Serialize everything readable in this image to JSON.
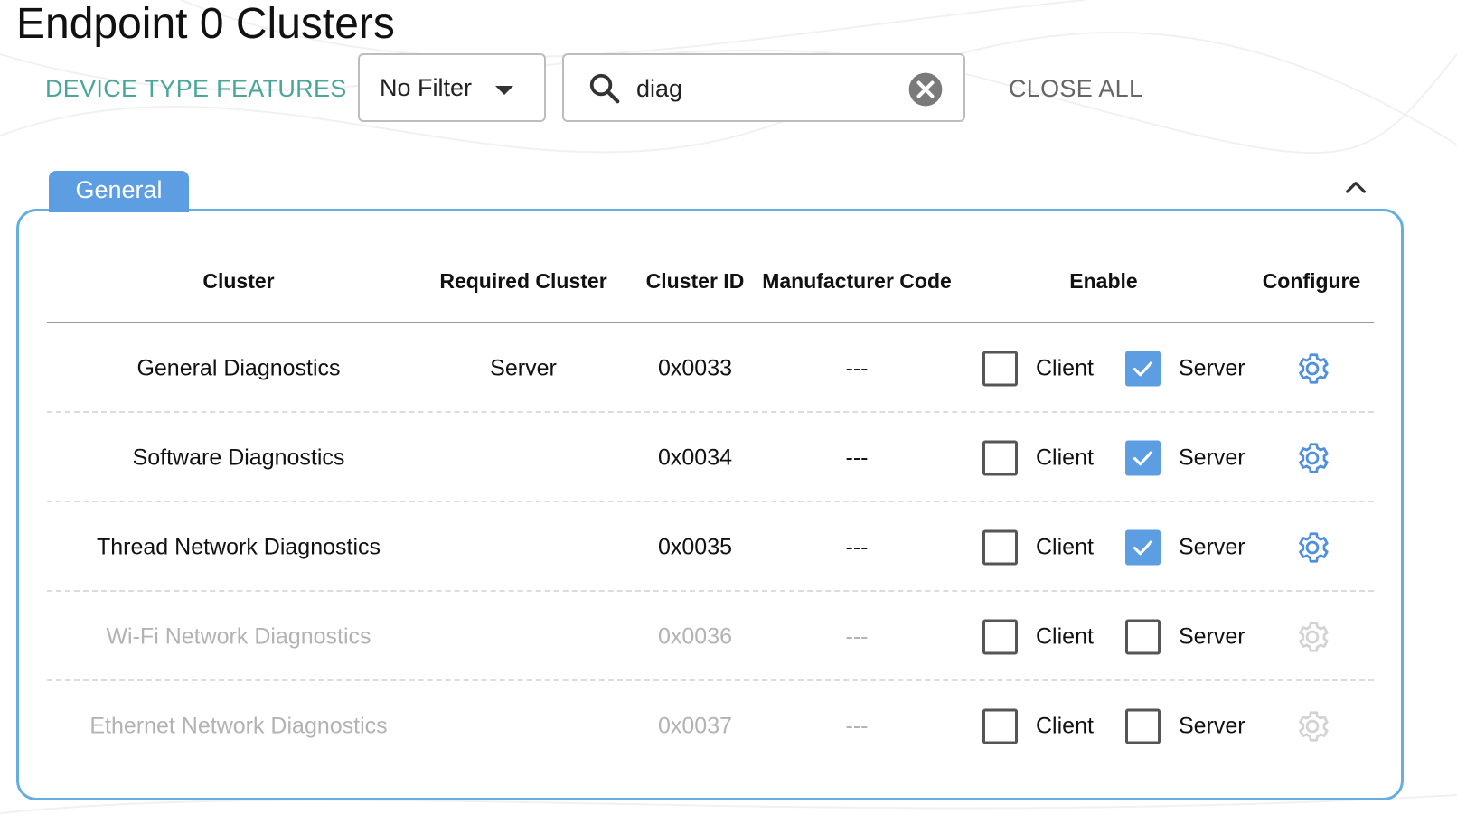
{
  "page_title": "Endpoint 0 Clusters",
  "toolbar": {
    "device_type_features": "DEVICE TYPE FEATURES",
    "filter_value": "No Filter",
    "search_value": "diag",
    "close_all": "CLOSE ALL"
  },
  "section": {
    "tab_label": "General"
  },
  "table": {
    "headers": {
      "cluster": "Cluster",
      "required": "Required Cluster",
      "cluster_id": "Cluster ID",
      "mfg_code": "Manufacturer Code",
      "enable": "Enable",
      "configure": "Configure"
    },
    "client_label": "Client",
    "server_label": "Server",
    "rows": [
      {
        "name": "General Diagnostics",
        "required": "Server",
        "id": "0x0033",
        "mfg": "---",
        "client": false,
        "server": true,
        "enabled": true
      },
      {
        "name": "Software Diagnostics",
        "required": "",
        "id": "0x0034",
        "mfg": "---",
        "client": false,
        "server": true,
        "enabled": true
      },
      {
        "name": "Thread Network Diagnostics",
        "required": "",
        "id": "0x0035",
        "mfg": "---",
        "client": false,
        "server": true,
        "enabled": true
      },
      {
        "name": "Wi-Fi Network Diagnostics",
        "required": "",
        "id": "0x0036",
        "mfg": "---",
        "client": false,
        "server": false,
        "enabled": false
      },
      {
        "name": "Ethernet Network Diagnostics",
        "required": "",
        "id": "0x0037",
        "mfg": "---",
        "client": false,
        "server": false,
        "enabled": false
      }
    ]
  },
  "colors": {
    "accent": "#4aa69a",
    "tab_blue": "#5d9ee3",
    "gear_active": "#4f8fe0",
    "gear_inactive": "#d3d3d3"
  }
}
